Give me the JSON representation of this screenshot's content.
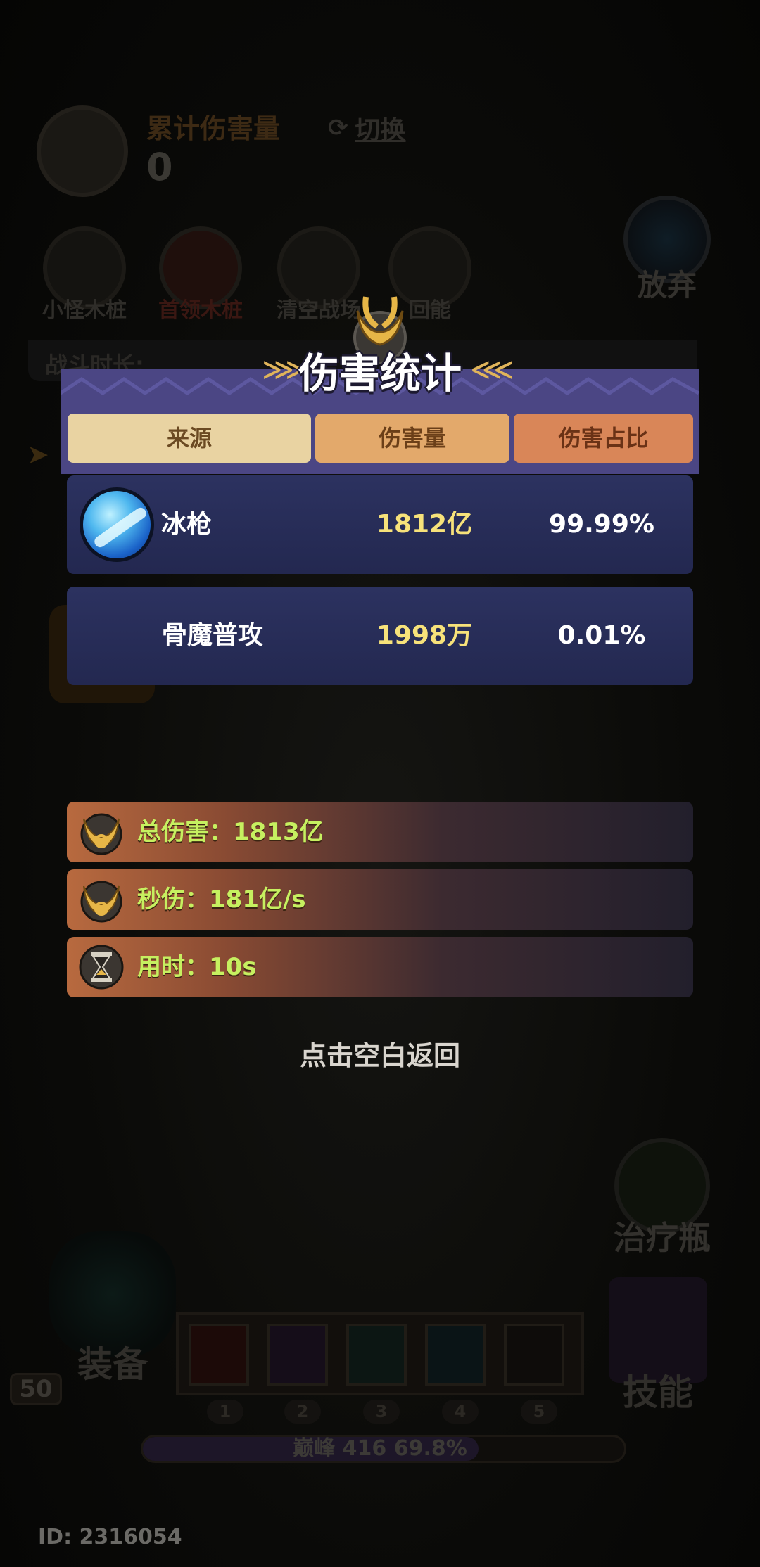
{
  "background": {
    "cumulative_damage_label": "累计伤害量",
    "cumulative_damage_value": "0",
    "switch_label": "切换",
    "give_up_label": "放弃",
    "stakes": [
      "小怪木桩",
      "首领木桩",
      "清空战场",
      "回能"
    ],
    "battle_time_label": "战斗时长:",
    "potion_label": "治疗瓶",
    "equip_label": "装备",
    "skill_label": "技能",
    "level": "50",
    "slot_numbers": [
      "1",
      "2",
      "3",
      "4",
      "5"
    ],
    "xp_text": "巅峰 416 69.8%",
    "xp_progress": 0.698,
    "user_id": "ID: 2316054"
  },
  "panel": {
    "title": "伤害统计",
    "columns": [
      "来源",
      "伤害量",
      "伤害占比"
    ],
    "rows": [
      {
        "name": "冰枪",
        "damage": "1812亿",
        "percent": "99.99%",
        "icon": "ice-spear-icon"
      },
      {
        "name": "骨魔普攻",
        "damage": "1998万",
        "percent": "0.01%"
      }
    ],
    "summary": [
      {
        "text": "总伤害：1813亿",
        "icon": "gold-emblem-icon"
      },
      {
        "text": "秒伤：181亿/s",
        "icon": "gold-emblem-icon"
      },
      {
        "text": "用时：10s",
        "icon": "hourglass-icon"
      }
    ],
    "dismiss_hint": "点击空白返回"
  },
  "colors": {
    "panel_header": "#4b4684",
    "row_bg": "#2c3260",
    "damage_text": "#f7e27a",
    "summary_text": "#c6f060"
  }
}
